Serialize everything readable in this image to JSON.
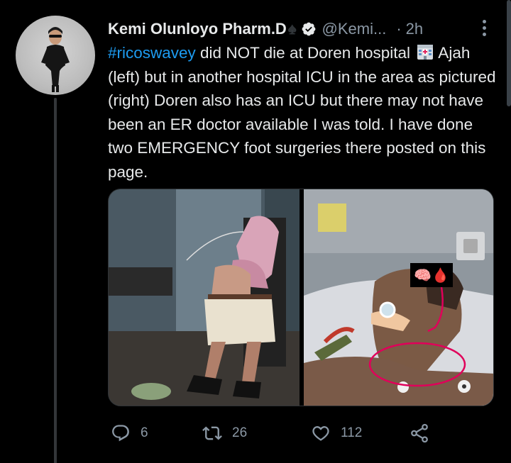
{
  "tweet": {
    "author": {
      "display_name": "Kemi Olunloyo Pharm.D",
      "name_emoji": "♠",
      "handle": "@Kemi...",
      "verified": true,
      "time_separator": "·",
      "time": "2h"
    },
    "text": {
      "hashtag": "#ricoswavey",
      "part1": " did NOT die at Doren hospital ",
      "part2": " Ajah (left) but in another hospital ICU in the area as pictured (right) Doren also has an ICU but there may not have been an ER doctor available I was told. I have done two EMERGENCY foot surgeries there posted on this page."
    },
    "media": {
      "left": "photo-patient-wheelchair",
      "right": "photo-patient-icu",
      "overlay_emojis": "🧠🩸"
    },
    "actions": {
      "reply_count": "6",
      "retweet_count": "26",
      "like_count": "112"
    },
    "icons": {
      "more": "more-icon",
      "reply": "reply-icon",
      "retweet": "retweet-icon",
      "like": "heart-icon",
      "share": "share-icon",
      "verified": "verified-badge-icon",
      "hospital": "hospital-emoji-icon"
    },
    "colors": {
      "background": "#000000",
      "text": "#e7e9ea",
      "secondary": "#8b98a5",
      "link": "#1d9bf0",
      "annotation": "#e0005a"
    }
  }
}
